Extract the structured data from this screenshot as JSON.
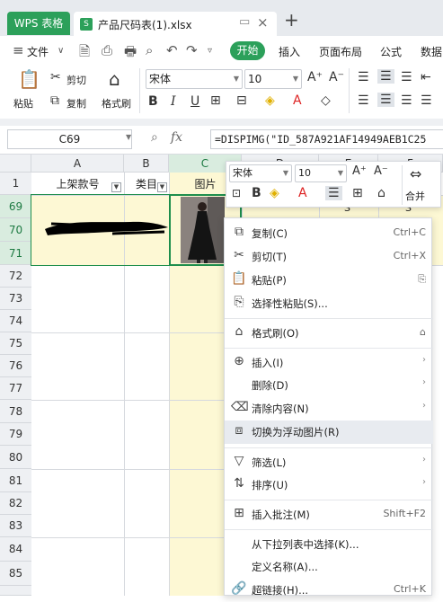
{
  "tabs": {
    "app": "WPS 表格",
    "file_badge": "S",
    "file": "产品尺码表(1).xlsx",
    "new": "+"
  },
  "menu": {
    "file": "文件",
    "start": "开始",
    "insert": "插入",
    "layout": "页面布局",
    "formula": "公式",
    "data": "数据"
  },
  "ribbon": {
    "paste": "粘贴",
    "cut": "剪切",
    "copy": "复制",
    "format_painter": "格式刷",
    "font": "宋体",
    "size": "10"
  },
  "formula_bar": {
    "name_box": "C69",
    "fx": "fx",
    "formula": "=DISPIMG(\"ID_587A921AF14949AEB1C25"
  },
  "columns": [
    "A",
    "B",
    "C",
    "D",
    "E",
    "F"
  ],
  "header_row": {
    "a": "上架款号",
    "b": "类目",
    "c": "图片"
  },
  "rows": [
    "1",
    "69",
    "70",
    "71",
    "72",
    "73",
    "74",
    "75",
    "76",
    "77",
    "78",
    "79",
    "80",
    "81",
    "82",
    "83",
    "84",
    "85"
  ],
  "cell_values": {
    "e": "S",
    "f": "S"
  },
  "mini_toolbar": {
    "font": "宋体",
    "size": "10",
    "merge": "合并"
  },
  "context_menu": [
    {
      "label": "复制(C)",
      "shortcut": "Ctrl+C",
      "icon": "copy-icon"
    },
    {
      "label": "剪切(T)",
      "shortcut": "Ctrl+X",
      "icon": "scissors-icon"
    },
    {
      "label": "粘贴(P)",
      "shortcut": "",
      "icon": "paste-icon"
    },
    {
      "label": "选择性粘贴(S)...",
      "shortcut": "",
      "icon": "paste-special-icon"
    },
    {
      "label": "格式刷(O)",
      "shortcut": "",
      "icon": "format-painter-icon"
    },
    {
      "label": "插入(I)",
      "shortcut": "",
      "icon": "insert-icon"
    },
    {
      "label": "删除(D)",
      "shortcut": "",
      "icon": ""
    },
    {
      "label": "清除内容(N)",
      "shortcut": "",
      "icon": "eraser-icon"
    },
    {
      "label": "切换为浮动图片(R)",
      "shortcut": "",
      "icon": "float-image-icon"
    },
    {
      "label": "筛选(L)",
      "shortcut": "",
      "icon": "filter-icon"
    },
    {
      "label": "排序(U)",
      "shortcut": "",
      "icon": "sort-icon"
    },
    {
      "label": "插入批注(M)",
      "shortcut": "Shift+F2",
      "icon": "comment-icon"
    },
    {
      "label": "从下拉列表中选择(K)...",
      "shortcut": "",
      "icon": ""
    },
    {
      "label": "定义名称(A)...",
      "shortcut": "",
      "icon": ""
    },
    {
      "label": "超链接(H)...",
      "shortcut": "Ctrl+K",
      "icon": "link-icon"
    }
  ],
  "colors": {
    "accent": "#2ca05a",
    "selection": "#fdf8d4",
    "menu_highlight": "#e8ebf0"
  }
}
